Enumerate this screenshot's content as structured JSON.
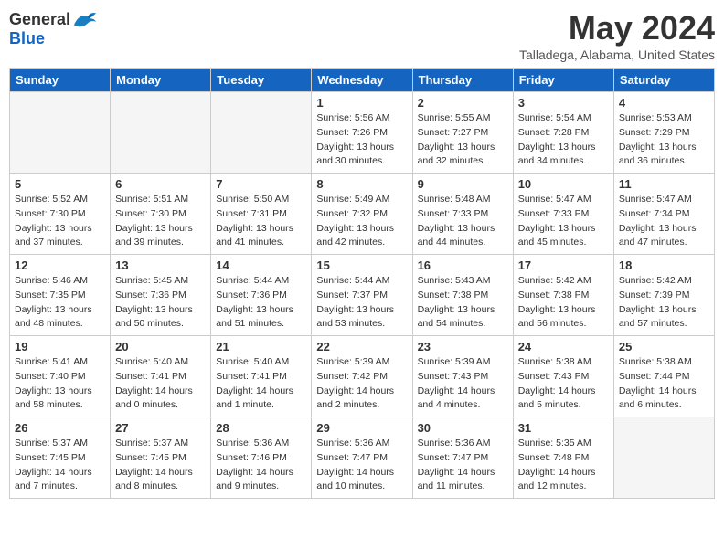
{
  "header": {
    "logo_general": "General",
    "logo_blue": "Blue",
    "title": "May 2024",
    "subtitle": "Talladega, Alabama, United States"
  },
  "weekdays": [
    "Sunday",
    "Monday",
    "Tuesday",
    "Wednesday",
    "Thursday",
    "Friday",
    "Saturday"
  ],
  "weeks": [
    [
      {
        "day": "",
        "empty": true
      },
      {
        "day": "",
        "empty": true
      },
      {
        "day": "",
        "empty": true
      },
      {
        "day": "1",
        "sunrise": "5:56 AM",
        "sunset": "7:26 PM",
        "daylight": "13 hours and 30 minutes."
      },
      {
        "day": "2",
        "sunrise": "5:55 AM",
        "sunset": "7:27 PM",
        "daylight": "13 hours and 32 minutes."
      },
      {
        "day": "3",
        "sunrise": "5:54 AM",
        "sunset": "7:28 PM",
        "daylight": "13 hours and 34 minutes."
      },
      {
        "day": "4",
        "sunrise": "5:53 AM",
        "sunset": "7:29 PM",
        "daylight": "13 hours and 36 minutes."
      }
    ],
    [
      {
        "day": "5",
        "sunrise": "5:52 AM",
        "sunset": "7:30 PM",
        "daylight": "13 hours and 37 minutes."
      },
      {
        "day": "6",
        "sunrise": "5:51 AM",
        "sunset": "7:30 PM",
        "daylight": "13 hours and 39 minutes."
      },
      {
        "day": "7",
        "sunrise": "5:50 AM",
        "sunset": "7:31 PM",
        "daylight": "13 hours and 41 minutes."
      },
      {
        "day": "8",
        "sunrise": "5:49 AM",
        "sunset": "7:32 PM",
        "daylight": "13 hours and 42 minutes."
      },
      {
        "day": "9",
        "sunrise": "5:48 AM",
        "sunset": "7:33 PM",
        "daylight": "13 hours and 44 minutes."
      },
      {
        "day": "10",
        "sunrise": "5:47 AM",
        "sunset": "7:33 PM",
        "daylight": "13 hours and 45 minutes."
      },
      {
        "day": "11",
        "sunrise": "5:47 AM",
        "sunset": "7:34 PM",
        "daylight": "13 hours and 47 minutes."
      }
    ],
    [
      {
        "day": "12",
        "sunrise": "5:46 AM",
        "sunset": "7:35 PM",
        "daylight": "13 hours and 48 minutes."
      },
      {
        "day": "13",
        "sunrise": "5:45 AM",
        "sunset": "7:36 PM",
        "daylight": "13 hours and 50 minutes."
      },
      {
        "day": "14",
        "sunrise": "5:44 AM",
        "sunset": "7:36 PM",
        "daylight": "13 hours and 51 minutes."
      },
      {
        "day": "15",
        "sunrise": "5:44 AM",
        "sunset": "7:37 PM",
        "daylight": "13 hours and 53 minutes."
      },
      {
        "day": "16",
        "sunrise": "5:43 AM",
        "sunset": "7:38 PM",
        "daylight": "13 hours and 54 minutes."
      },
      {
        "day": "17",
        "sunrise": "5:42 AM",
        "sunset": "7:38 PM",
        "daylight": "13 hours and 56 minutes."
      },
      {
        "day": "18",
        "sunrise": "5:42 AM",
        "sunset": "7:39 PM",
        "daylight": "13 hours and 57 minutes."
      }
    ],
    [
      {
        "day": "19",
        "sunrise": "5:41 AM",
        "sunset": "7:40 PM",
        "daylight": "13 hours and 58 minutes."
      },
      {
        "day": "20",
        "sunrise": "5:40 AM",
        "sunset": "7:41 PM",
        "daylight": "14 hours and 0 minutes."
      },
      {
        "day": "21",
        "sunrise": "5:40 AM",
        "sunset": "7:41 PM",
        "daylight": "14 hours and 1 minute."
      },
      {
        "day": "22",
        "sunrise": "5:39 AM",
        "sunset": "7:42 PM",
        "daylight": "14 hours and 2 minutes."
      },
      {
        "day": "23",
        "sunrise": "5:39 AM",
        "sunset": "7:43 PM",
        "daylight": "14 hours and 4 minutes."
      },
      {
        "day": "24",
        "sunrise": "5:38 AM",
        "sunset": "7:43 PM",
        "daylight": "14 hours and 5 minutes."
      },
      {
        "day": "25",
        "sunrise": "5:38 AM",
        "sunset": "7:44 PM",
        "daylight": "14 hours and 6 minutes."
      }
    ],
    [
      {
        "day": "26",
        "sunrise": "5:37 AM",
        "sunset": "7:45 PM",
        "daylight": "14 hours and 7 minutes."
      },
      {
        "day": "27",
        "sunrise": "5:37 AM",
        "sunset": "7:45 PM",
        "daylight": "14 hours and 8 minutes."
      },
      {
        "day": "28",
        "sunrise": "5:36 AM",
        "sunset": "7:46 PM",
        "daylight": "14 hours and 9 minutes."
      },
      {
        "day": "29",
        "sunrise": "5:36 AM",
        "sunset": "7:47 PM",
        "daylight": "14 hours and 10 minutes."
      },
      {
        "day": "30",
        "sunrise": "5:36 AM",
        "sunset": "7:47 PM",
        "daylight": "14 hours and 11 minutes."
      },
      {
        "day": "31",
        "sunrise": "5:35 AM",
        "sunset": "7:48 PM",
        "daylight": "14 hours and 12 minutes."
      },
      {
        "day": "",
        "empty": true
      }
    ]
  ]
}
